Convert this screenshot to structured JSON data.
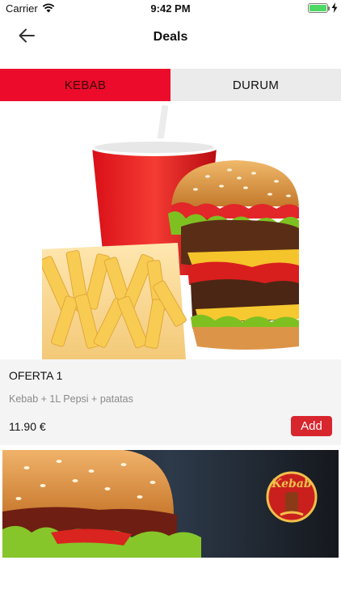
{
  "status_bar": {
    "carrier": "Carrier",
    "time": "9:42 PM",
    "battery_level": 1.0
  },
  "nav": {
    "title": "Deals",
    "back_icon": "arrow-left-icon"
  },
  "tabs": [
    {
      "label": "KEBAB",
      "active": true
    },
    {
      "label": "DURUM",
      "active": false
    }
  ],
  "deals": [
    {
      "title": "OFERTA 1",
      "description": "Kebab + 1L Pepsi + patatas",
      "price": "11.90 €",
      "add_label": "Add",
      "image": "burger-fries-drink-photo"
    },
    {
      "image": "burger-kebab-logo-photo",
      "logo_text": "Kebab"
    }
  ],
  "colors": {
    "accent": "#ec0b2b",
    "add_button": "#d8262e",
    "tab_inactive": "#ebebeb",
    "card_bg": "#f4f4f4"
  }
}
